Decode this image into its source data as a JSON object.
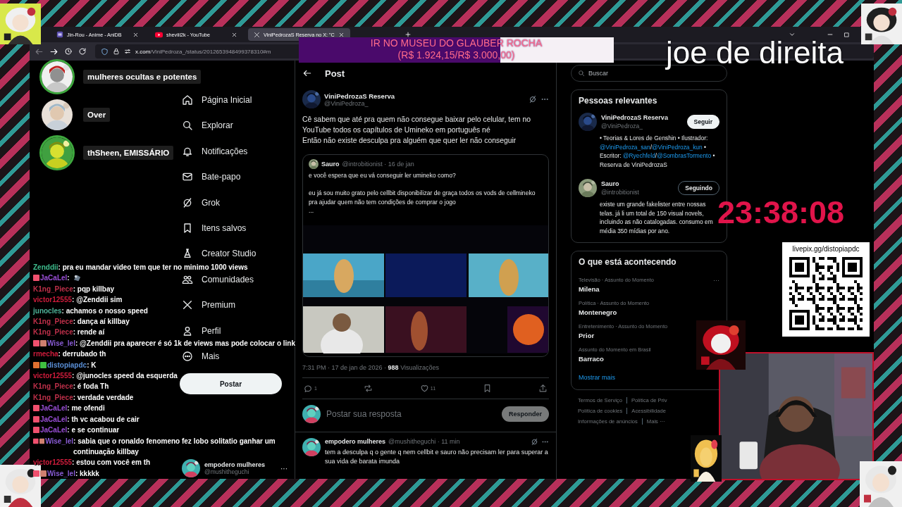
{
  "browser": {
    "tabs": [
      {
        "kind": "anidb",
        "title": "Jin-Rou - Anime - AniDB",
        "selected": false
      },
      {
        "kind": "youtube",
        "title": "sheviii2k - YouTube",
        "selected": false
      },
      {
        "kind": "x",
        "title": "ViniPedrozaS Reserva no X: \"C",
        "selected": true
      }
    ],
    "back_disabled": true,
    "address": {
      "host": "x.com",
      "path": "/ViniPedroza_/status/2012653948499378310#m"
    }
  },
  "nav": {
    "items": [
      {
        "kind": "home",
        "label": "Página Inicial"
      },
      {
        "kind": "explore",
        "label": "Explorar"
      },
      {
        "kind": "notifications",
        "label": "Notificações"
      },
      {
        "kind": "chat",
        "label": "Bate-papo"
      },
      {
        "kind": "grok",
        "label": "Grok"
      },
      {
        "kind": "bookmarks",
        "label": "Itens salvos"
      },
      {
        "kind": "studio",
        "label": "Creator Studio"
      },
      {
        "kind": "communities",
        "label": "Comunidades"
      },
      {
        "kind": "premium",
        "label": "Premium"
      },
      {
        "kind": "profile",
        "label": "Perfil"
      },
      {
        "kind": "more",
        "label": "Mais"
      }
    ],
    "post_button": "Postar",
    "account": {
      "name": "empodero mulheres",
      "handle": "@mushitheguchi",
      "menu": "···"
    }
  },
  "post": {
    "header": {
      "title": "Post"
    },
    "tweet": {
      "author": "ViniPedrozaS Reserva",
      "handle": "@ViniPedroza_",
      "text": "Cê sabem que até pra quem não consegue baixar pelo celular, tem no\nYouTube todos os capítulos de Umineko em português né\nEntão não existe desculpa pra alguém que quer ler não conseguir",
      "quote": {
        "author": "Sauro",
        "meta": "@introbitionist · 16 de jan",
        "text": "e você espera que eu vá conseguir ler umineko como?\n\neu já sou muito grato pelo cellbit disponibilizar de graça todos os vods de cellmineko pra ajudar quem não tem condições de comprar o jogo\n..."
      },
      "meta": "7:31 PM · 17 de jan de 2026 · **988** Visualizações",
      "actions": [
        {
          "kind": "reply",
          "count": "1"
        },
        {
          "kind": "repost"
        },
        {
          "kind": "like",
          "count": "11"
        },
        {
          "kind": "bookmark"
        },
        {
          "kind": "share"
        }
      ]
    },
    "reply_box": {
      "placeholder": "Postar sua resposta",
      "button": "Responder",
      "disabled": true
    },
    "replies": [
      {
        "author": "empodero mulheres",
        "meta": "@mushitheguchi · 11 min",
        "text": "tem a desculpa q o gente q nem cellbit e sauro não precisam ler para superar a sua vida de barata imunda"
      }
    ]
  },
  "sidebar": {
    "search": {
      "placeholder": "Buscar"
    },
    "people": {
      "title": "Pessoas relevantes",
      "items": [
        {
          "name": "ViniPedrozaS Reserva",
          "handle": "@ViniPedroza_",
          "button": "Seguir",
          "following": false,
          "bio": [
            {
              "text": "• Teorias & Lores de Genshin • Ilustrador: ",
              "link": false
            },
            {
              "text": "@ViniPedroza_san",
              "link": true
            },
            {
              "text": "/",
              "link": false
            },
            {
              "text": "@ViniPedroza_kun",
              "link": true
            },
            {
              "text": " • Escritor: ",
              "link": false
            },
            {
              "text": "@Ryechfeld",
              "link": true
            },
            {
              "text": "/",
              "link": false
            },
            {
              "text": "@SombrasTormento",
              "link": true
            },
            {
              "text": " • Reserva de ViniPedrozaS",
              "link": false
            }
          ]
        },
        {
          "name": "Sauro",
          "handle": "@introbitionist",
          "button": "Seguindo",
          "following": true,
          "bio": [
            {
              "text": "existe um grande fakelister entre nossas telas. já li um total de 150 visual novels, incluindo as não catalogadas. consumo em média 350 mídias por ano.",
              "link": false
            }
          ]
        }
      ]
    },
    "trends": {
      "title": "O que está acontecendo",
      "items": [
        {
          "context": "Televisão · Assunto do Momento",
          "name": "Milena",
          "menu": "···"
        },
        {
          "context": "Política · Assunto do Momento",
          "name": "Montenegro"
        },
        {
          "context": "Entretenimento · Assunto do Momento",
          "name": "Prior"
        },
        {
          "context": "Assunto do Momento em Brasil",
          "name": "Barraco"
        }
      ],
      "more": "Mostrar mais"
    },
    "footer": [
      [
        "Termos de Serviço",
        "Política de Priv"
      ],
      [
        "Política de cookies",
        "Acessibilidade"
      ],
      [
        "Informações de anúncios",
        "Mais ···"
      ]
    ]
  },
  "overlay": {
    "voice": [
      {
        "name": "mulheres ocultas e potentes",
        "speaking": true
      },
      {
        "name": "Over",
        "speaking": false
      },
      {
        "name": "thSheen, EMISSÁRIO",
        "speaking": true
      }
    ],
    "goal": {
      "title": "IR NO MUSEU DO GLAUBER ROCHA",
      "amount": "(R$ 1.924,15/R$ 3.000,00)",
      "level": 0.64
    },
    "stream_title": "joe de direita",
    "clock": "23:38:08",
    "qr": {
      "url": "livepix.gg/distopiapdc"
    },
    "chat": [
      {
        "kind": "text",
        "user": "Zenddii",
        "color": "#3fbf8f",
        "text": ": pra eu mandar video tem que ter no minimo 1000 views"
      },
      {
        "kind": "emote",
        "user": "JaCaLel",
        "color": "#9b4fd8",
        "badges": [
          {
            "color": "#f0506e"
          }
        ],
        "text": ":"
      },
      {
        "kind": "text",
        "user": "K1ng_Piece",
        "color": "#c0304a",
        "text": ": pqp killbay"
      },
      {
        "kind": "text",
        "user": "victor12555",
        "color": "#d01c3c",
        "text": ": @Zenddii sim"
      },
      {
        "kind": "text",
        "user": "junocles",
        "color": "#4fb39a",
        "text": ": achamos o nosso speed"
      },
      {
        "kind": "text",
        "user": "K1ng_Piece",
        "color": "#c0304a",
        "text": ": dança aí killbay"
      },
      {
        "kind": "text",
        "user": "K1ng_Piece",
        "color": "#c0304a",
        "text": ": rende aí"
      },
      {
        "kind": "text",
        "user": "Wise_lel",
        "color": "#8a5cd6",
        "badges": [
          {
            "color": "#f0506e"
          },
          {
            "color": "#d08070"
          }
        ],
        "text": ": @Zenddii pra aparecer é só 1k de views mas pode colocar o link"
      },
      {
        "kind": "text",
        "user": "rmecha",
        "color": "#d01c3c",
        "text": ": derrubado th"
      },
      {
        "kind": "text",
        "user": "distopiapdc",
        "color": "#5a8fd6",
        "badges": [
          {
            "color": "#e07030"
          },
          {
            "color": "#40c040"
          }
        ],
        "text": ": K"
      },
      {
        "kind": "text",
        "user": "victor12555",
        "color": "#d01c3c",
        "text": ": @junocles speed da esquerda"
      },
      {
        "kind": "text",
        "user": "K1ng_Piece",
        "color": "#c0304a",
        "text": ": é foda Th"
      },
      {
        "kind": "text",
        "user": "K1ng_Piece",
        "color": "#c0304a",
        "text": ": verdade verdade"
      },
      {
        "kind": "text",
        "user": "JaCaLel",
        "color": "#9b4fd8",
        "badges": [
          {
            "color": "#f0506e"
          }
        ],
        "text": ": me ofendi"
      },
      {
        "kind": "text",
        "user": "JaCaLel",
        "color": "#9b4fd8",
        "badges": [
          {
            "color": "#f0506e"
          }
        ],
        "text": ": th vc acabou de cair"
      },
      {
        "kind": "text",
        "user": "JaCaLel",
        "color": "#9b4fd8",
        "badges": [
          {
            "color": "#f0506e"
          }
        ],
        "text": ": e se continuar"
      },
      {
        "kind": "text",
        "user": "Wise_lel",
        "color": "#8a5cd6",
        "badges": [
          {
            "color": "#f0506e"
          },
          {
            "color": "#d08070"
          }
        ],
        "text": ": sabia que o ronaldo fenomeno fez lobo solitatio ganhar um continuação killbay"
      },
      {
        "kind": "text",
        "user": "victor12555",
        "color": "#d01c3c",
        "text": ": estou com você em th"
      },
      {
        "kind": "text",
        "user": "Wise_lel",
        "color": "#8a5cd6",
        "badges": [
          {
            "color": "#f0506e"
          },
          {
            "color": "#d08070"
          }
        ],
        "text": ": kkkkk"
      }
    ]
  }
}
